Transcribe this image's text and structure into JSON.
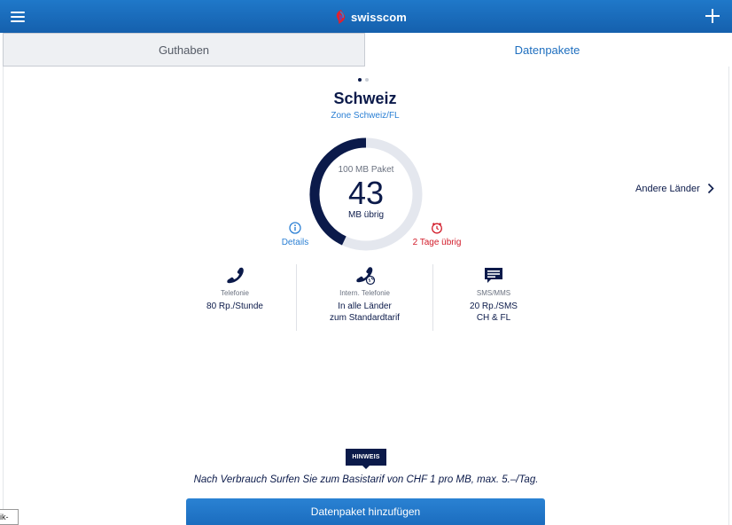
{
  "app": {
    "brand": "swisscom"
  },
  "tabs": [
    {
      "label": "Guthaben",
      "active": false
    },
    {
      "label": "Datenpakete",
      "active": true
    }
  ],
  "pager": {
    "pages": 2,
    "current": 1
  },
  "region": {
    "title": "Schweiz",
    "zone": "Zone Schweiz/FL"
  },
  "chart_data": {
    "type": "pie",
    "subtype": "donut-gauge",
    "title": "100 MB Paket",
    "center_value": "43",
    "center_unit": "MB übrig",
    "max": 100,
    "values": [
      43,
      57
    ],
    "colors": [
      "#0b1a4a",
      "#e4e7ee"
    ]
  },
  "package": {
    "details_label": "Details",
    "days_left_label": "2 Tage übrig"
  },
  "other_countries": "Andere Länder",
  "rates": [
    {
      "title": "Telefonie",
      "value_lines": [
        "80 Rp./Stunde"
      ],
      "icon": "phone-icon"
    },
    {
      "title": "Intern. Telefonie",
      "value_lines": [
        "In alle Länder",
        "zum Standardtarif"
      ],
      "icon": "international-phone-icon"
    },
    {
      "title": "SMS/MMS",
      "value_lines": [
        "20 Rp./SMS",
        "CH & FL"
      ],
      "icon": "message-icon"
    }
  ],
  "hint": {
    "badge": "HINWEIS",
    "text": "Nach Verbrauch Surfen Sie zum Basistarif von CHF 1 pro MB, max. 5.–/Tag."
  },
  "add_button": "Datenpaket hinzufügen",
  "corner_tooltip": "ik-",
  "colors": {
    "brand_blue": "#1560ad",
    "navy": "#0b1a4a",
    "link_blue": "#2a7fd4",
    "alert_red": "#d21c2a"
  }
}
